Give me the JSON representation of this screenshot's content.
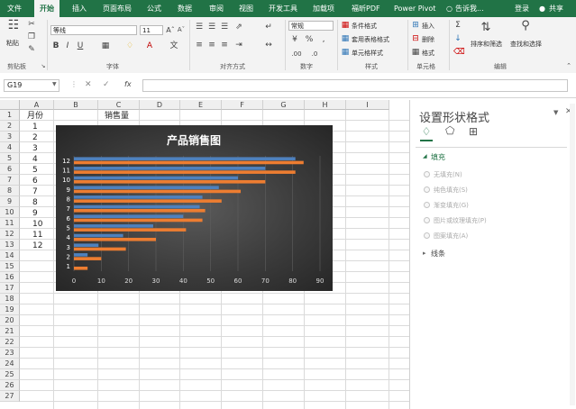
{
  "menu": {
    "tabs": [
      "文件",
      "开始",
      "插入",
      "页面布局",
      "公式",
      "数据",
      "审阅",
      "视图",
      "开发工具",
      "加载项",
      "福昕PDF",
      "Power Pivot"
    ],
    "tell_me": "告诉我...",
    "login": "登录",
    "share": "共享"
  },
  "ribbon": {
    "paste": "粘贴",
    "clipboard_group": "剪贴板",
    "font_name": "等线",
    "font_size": "11",
    "font_group": "字体",
    "align_group": "对齐方式",
    "number_format": "常规",
    "number_group": "数字",
    "cond_format": "条件格式",
    "table_format": "套用表格格式",
    "cell_style": "单元格样式",
    "style_group": "样式",
    "insert": "插入",
    "delete": "删除",
    "format": "格式",
    "cells_group": "单元格",
    "sort_filter": "排序和筛选",
    "find_select": "查找和选择",
    "edit_group": "编辑"
  },
  "formula_bar": {
    "name_box": "G19",
    "fx": "fx",
    "formula": ""
  },
  "sheet": {
    "columns": [
      "A",
      "B",
      "C",
      "D",
      "E",
      "F",
      "G",
      "H",
      "I"
    ],
    "rows": [
      "1",
      "2",
      "3",
      "4",
      "5",
      "6",
      "7",
      "8",
      "9",
      "10",
      "11",
      "12",
      "13",
      "14",
      "15",
      "16",
      "17",
      "18",
      "19",
      "20",
      "21",
      "22",
      "23",
      "24",
      "25",
      "26",
      "27"
    ],
    "a1": "月份",
    "c1": "销售量",
    "months": [
      "1",
      "2",
      "3",
      "4",
      "5",
      "6",
      "7",
      "8",
      "9",
      "10",
      "11",
      "12"
    ]
  },
  "chart_data": {
    "type": "bar",
    "title": "产品销售图",
    "categories": [
      "1",
      "2",
      "3",
      "4",
      "5",
      "6",
      "7",
      "8",
      "9",
      "10",
      "11",
      "12"
    ],
    "series": [
      {
        "values": [
          0,
          5,
          9,
          18,
          29,
          40,
          46,
          47,
          53,
          60,
          70,
          81
        ],
        "color": "#4f81bd"
      },
      {
        "values": [
          5,
          10,
          19,
          30,
          41,
          47,
          48,
          54,
          61,
          70,
          81,
          84
        ],
        "color": "#ed7d31"
      }
    ],
    "xticks": [
      0,
      10,
      20,
      30,
      40,
      50,
      60,
      70,
      80,
      90
    ],
    "xlim": [
      0,
      90
    ],
    "grid": true,
    "legend": "none"
  },
  "pane": {
    "title": "设置形状格式",
    "fill_section": "填充",
    "fill_options": [
      "无填充(N)",
      "纯色填充(S)",
      "渐变填充(G)",
      "图片或纹理填充(P)",
      "图案填充(A)"
    ],
    "line_section": "线条"
  }
}
